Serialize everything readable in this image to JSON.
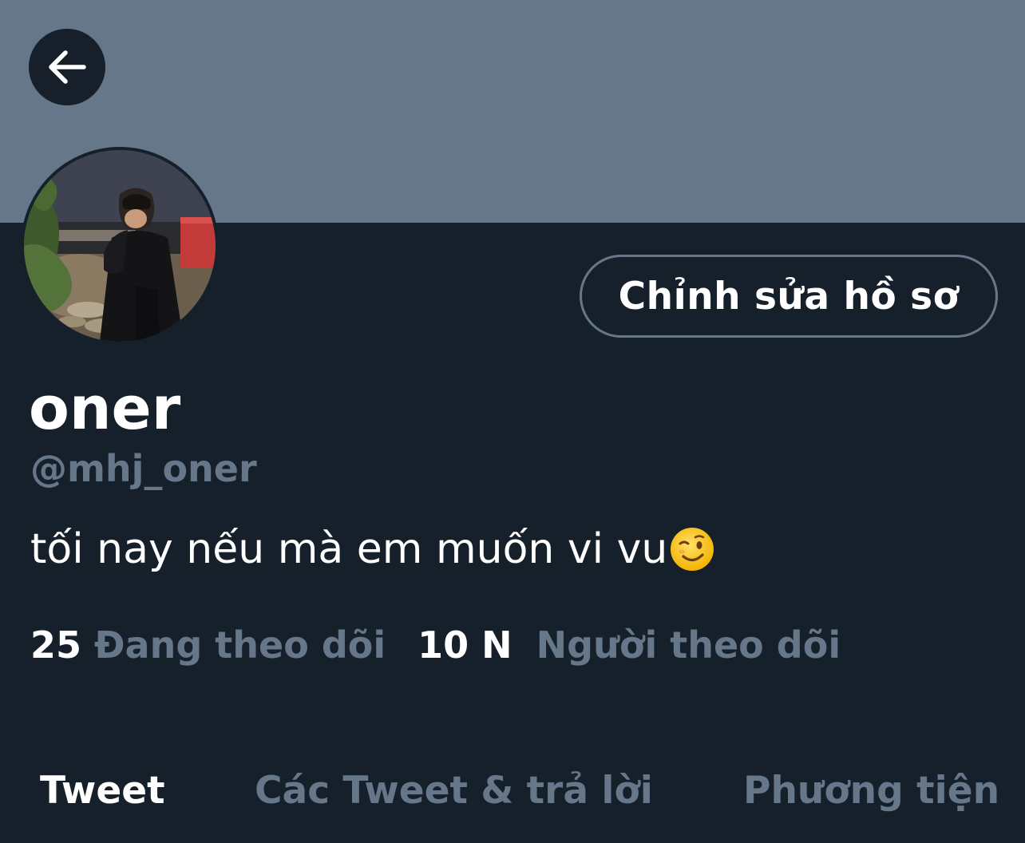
{
  "profile": {
    "display_name": "oner",
    "handle": "@mhj_oner",
    "bio": "tối nay nếu mà em muốn vi vu",
    "bio_emoji": "winking-face-icon"
  },
  "header": {
    "back_icon": "arrow-left-icon",
    "banner_color": "#66778a"
  },
  "actions": {
    "edit_profile_label": "Chỉnh sửa hồ sơ"
  },
  "stats": {
    "following_count": "25",
    "following_label": "Đang theo dõi",
    "followers_count": "10 N",
    "followers_label": "Người theo dõi"
  },
  "tabs": [
    {
      "label": "Tweet",
      "active": true
    },
    {
      "label": "Các Tweet & trả lời",
      "active": false
    },
    {
      "label": "Phương tiện",
      "active": false
    }
  ],
  "colors": {
    "background": "#15202b",
    "muted_text": "#66778a",
    "primary_text": "#ffffff"
  }
}
